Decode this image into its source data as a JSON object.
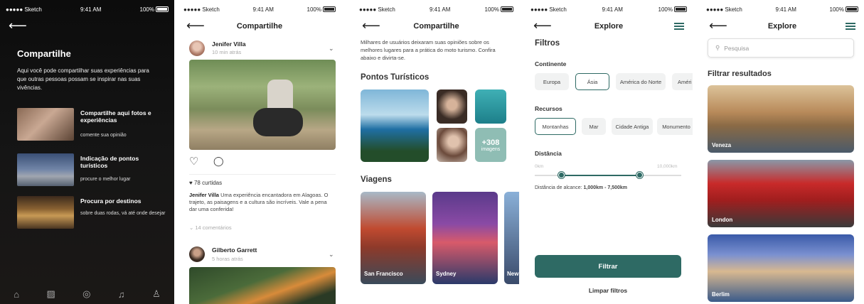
{
  "status": {
    "carrier": "●●●●● Sketch",
    "wifi": "≈",
    "time": "9:41 AM",
    "battery": "100%"
  },
  "colors": {
    "accent": "#2e6a64"
  },
  "screen1": {
    "title": "Compartilhe",
    "description": "Aqui você pode compartilhar suas experiências para que outras pessoas possam se inspirar nas suas vivências.",
    "items": [
      {
        "title": "Compartilhe aqui fotos e experiências",
        "subtitle": "comente sua opinião"
      },
      {
        "title": "Indicação de pontos turísticos",
        "subtitle": "procure o melhor lugar"
      },
      {
        "title": "Procura por destinos",
        "subtitle": "sobre duas rodas, vá até onde desejar"
      }
    ],
    "nav": [
      "home-icon",
      "gallery-icon",
      "location-icon",
      "notification-icon",
      "profile-icon"
    ]
  },
  "screen2": {
    "title": "Compartilhe",
    "post1": {
      "user": "Jenifer Villa",
      "time": "10 min atrás",
      "likes": "78 curtidas",
      "caption_user": "Jenifer Villa",
      "caption": "Uma experiência encantadora em Alagoas. O trajeto, as paisagens e a cultura são incríveis. Vale a pena dar uma conferida!",
      "comments": "14 comentários"
    },
    "post2": {
      "user": "Gilberto Garrett",
      "time": "5 horas atrás"
    }
  },
  "screen3": {
    "title": "Compartilhe",
    "intro": "Milhares de usuários deixaram suas opiniões sobre os melhores lugares para a prática do moto turismo. Confira abaixo e divirta-se.",
    "section1": "Pontos Turísticos",
    "more_count": "+308",
    "more_label": "imagens",
    "section2": "Viagens",
    "trips": [
      "San Francisco",
      "Sydney",
      "New"
    ]
  },
  "screen4": {
    "title": "Explore",
    "heading": "Filtros",
    "continent_label": "Continente",
    "continents": [
      "Europa",
      "Ásia",
      "América do Norte",
      "Améri"
    ],
    "resources_label": "Recursos",
    "resources": [
      "Montanhas",
      "Mar",
      "Cidade Antiga",
      "Monumento"
    ],
    "distance_label": "Distância",
    "range_min": "0km",
    "range_max": "10,000km",
    "range_text": "Distância de alcance:",
    "range_value": "1,000km - 7,500km",
    "filter_button": "Filtrar",
    "clear_button": "Limpar filtros"
  },
  "screen5": {
    "title": "Explore",
    "search_placeholder": "Pesquisa",
    "heading": "Filtrar resultados",
    "cities": [
      "Veneza",
      "London",
      "Berlim"
    ]
  }
}
